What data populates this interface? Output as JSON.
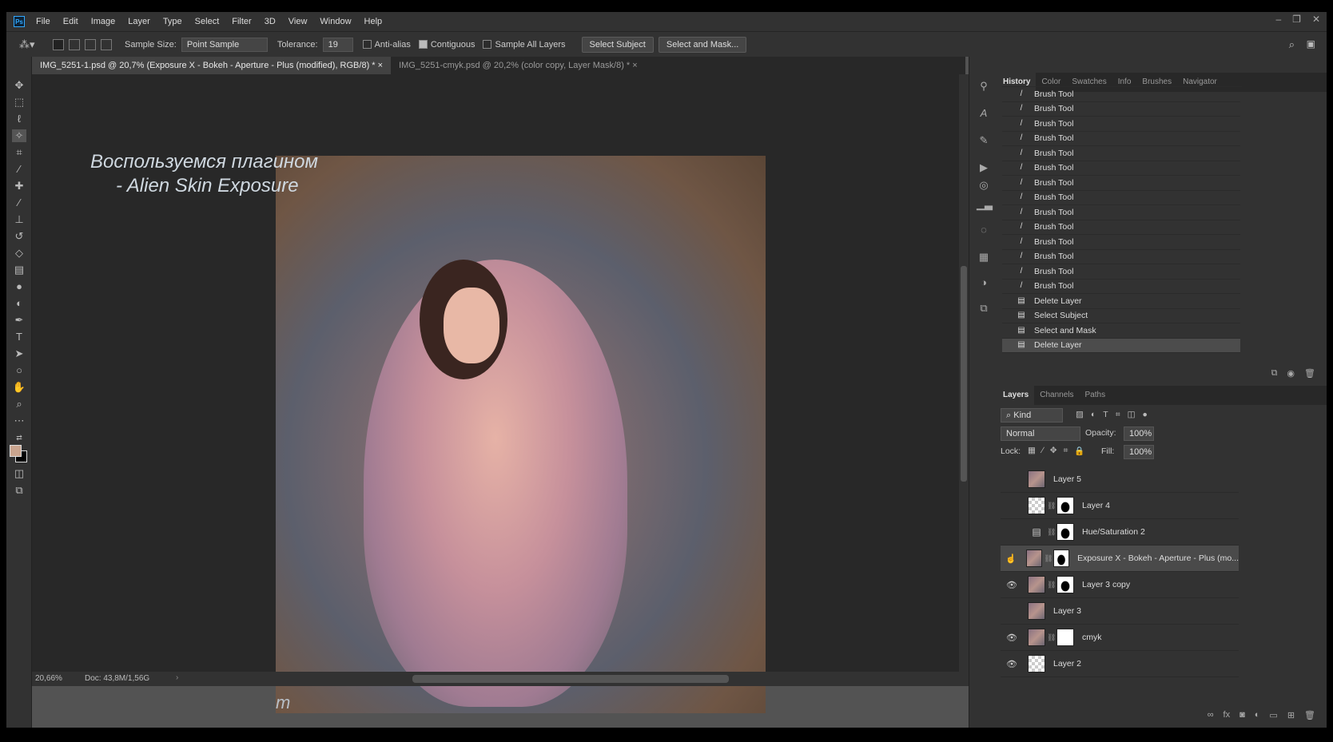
{
  "app": {
    "icon": "Ps"
  },
  "menu": [
    "File",
    "Edit",
    "Image",
    "Layer",
    "Type",
    "Select",
    "Filter",
    "3D",
    "View",
    "Window",
    "Help"
  ],
  "window_controls": {
    "minimize": "–",
    "restore": "❐",
    "close": "✕"
  },
  "options": {
    "sample_size_label": "Sample Size:",
    "sample_size_value": "Point Sample",
    "tolerance_label": "Tolerance:",
    "tolerance_value": "19",
    "anti_alias": "Anti-alias",
    "contiguous": "Contiguous",
    "sample_all_layers": "Sample All Layers",
    "select_subject": "Select Subject",
    "select_and_mask": "Select and Mask..."
  },
  "tabs": [
    {
      "label": "IMG_5251-1.psd @ 20,7% (Exposure X - Bokeh - Aperture - Plus (modified), RGB/8) *",
      "close": "×"
    },
    {
      "label": "IMG_5251-cmyk.psd @ 20,2% (color copy, Layer Mask/8) *",
      "close": "×"
    }
  ],
  "canvas": {
    "caption_line1": "Воспользуемся плагином",
    "caption_line2": "- Alien Skin Exposure",
    "watermark": "m"
  },
  "status": {
    "zoom": "20,66%",
    "doc": "Doc: 43,8M/1,56G"
  },
  "history": {
    "tabs": [
      "History",
      "Color",
      "Swatches",
      "Info",
      "Brushes",
      "Navigator"
    ],
    "items": [
      {
        "label": "Brush Tool",
        "icon": "brush-icon"
      },
      {
        "label": "Brush Tool",
        "icon": "brush-icon"
      },
      {
        "label": "Brush Tool",
        "icon": "brush-icon"
      },
      {
        "label": "Brush Tool",
        "icon": "brush-icon"
      },
      {
        "label": "Brush Tool",
        "icon": "brush-icon"
      },
      {
        "label": "Brush Tool",
        "icon": "brush-icon"
      },
      {
        "label": "Brush Tool",
        "icon": "brush-icon"
      },
      {
        "label": "Brush Tool",
        "icon": "brush-icon"
      },
      {
        "label": "Brush Tool",
        "icon": "brush-icon"
      },
      {
        "label": "Brush Tool",
        "icon": "brush-icon"
      },
      {
        "label": "Brush Tool",
        "icon": "brush-icon"
      },
      {
        "label": "Brush Tool",
        "icon": "brush-icon"
      },
      {
        "label": "Brush Tool",
        "icon": "brush-icon"
      },
      {
        "label": "Brush Tool",
        "icon": "brush-icon"
      },
      {
        "label": "Delete Layer",
        "icon": "document-icon"
      },
      {
        "label": "Select Subject",
        "icon": "document-icon"
      },
      {
        "label": "Select and Mask",
        "icon": "document-icon"
      },
      {
        "label": "Delete Layer",
        "icon": "document-icon"
      }
    ]
  },
  "layers": {
    "tabs": [
      "Layers",
      "Channels",
      "Paths"
    ],
    "kind": "Kind",
    "blend_mode": "Normal",
    "opacity_label": "Opacity:",
    "opacity": "100%",
    "lock_label": "Lock:",
    "fill_label": "Fill:",
    "fill": "100%",
    "items": [
      {
        "name": "Layer 5",
        "visible": false
      },
      {
        "name": "Layer 4",
        "visible": false
      },
      {
        "name": "Hue/Saturation 2",
        "visible": false
      },
      {
        "name": "Exposure X - Bokeh - Aperture - Plus (mo...",
        "visible": false,
        "selected": true
      },
      {
        "name": "Layer 3 copy",
        "visible": true
      },
      {
        "name": "Layer 3",
        "visible": false
      },
      {
        "name": "cmyk",
        "visible": true
      },
      {
        "name": "Layer 2",
        "visible": true
      }
    ]
  },
  "colors": {
    "foreground": "#c9a48e",
    "background": "#000000",
    "accent": "#31a8ff"
  }
}
